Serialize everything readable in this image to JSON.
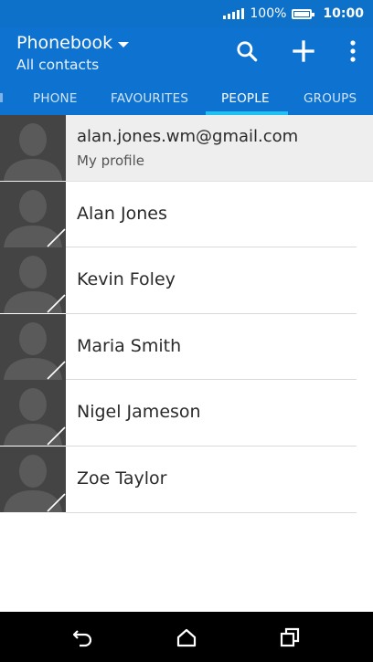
{
  "status_bar": {
    "battery_percent": "100%",
    "time": "10:00",
    "icons": [
      "signal-icon",
      "battery-icon"
    ]
  },
  "app_bar": {
    "title": "Phonebook",
    "subtitle": "All contacts",
    "actions": [
      "search-icon",
      "add-icon",
      "more-options-icon"
    ]
  },
  "tabs": [
    {
      "label": "PHONE",
      "active": false
    },
    {
      "label": "FAVOURITES",
      "active": false
    },
    {
      "label": "PEOPLE",
      "active": true
    },
    {
      "label": "GROUPS",
      "active": false
    }
  ],
  "profile": {
    "email": "alan.jones.wm@gmail.com",
    "label": "My profile"
  },
  "contacts": [
    {
      "name": "Alan Jones"
    },
    {
      "name": "Kevin Foley"
    },
    {
      "name": "Maria Smith"
    },
    {
      "name": "Nigel Jameson"
    },
    {
      "name": "Zoe Taylor"
    }
  ],
  "nav_bar": {
    "buttons": [
      "back-icon",
      "home-icon",
      "recent-apps-icon"
    ]
  },
  "colors": {
    "primary": "#0e73d0",
    "status_bar": "#0d70c9",
    "tab_indicator": "#21c0f2",
    "avatar_bg": "#444444"
  }
}
